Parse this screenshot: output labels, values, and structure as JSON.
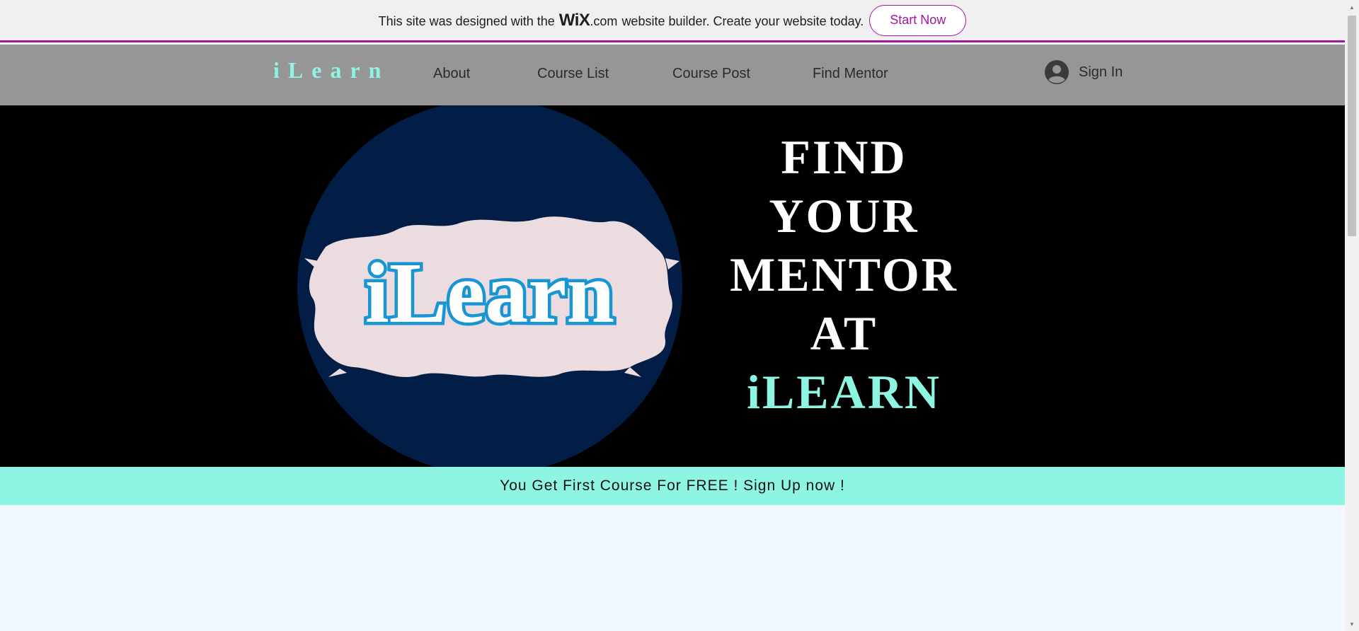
{
  "wix_banner": {
    "text_before": "This site was designed with the",
    "logo": "WiX",
    "logo_suffix": ".com",
    "text_after": "website builder. Create your website today.",
    "cta_label": "Start Now",
    "accent_color": "#a0179a"
  },
  "header": {
    "brand": "iLearn",
    "nav": [
      "About",
      "Course List",
      "Course Post",
      "Find Mentor"
    ],
    "signin_label": "Sign In",
    "signin_icon": "user-avatar-icon",
    "background_color": "#969696",
    "brand_color": "#8ff5e3"
  },
  "hero": {
    "logo_text": "iLearn",
    "headline_lines": [
      "FIND",
      "YOUR",
      "MENTOR",
      "AT"
    ],
    "headline_accent": "iLEARN",
    "circle_color": "#031e46",
    "accent_color": "#8ff5e3"
  },
  "promo": {
    "text": "You Get First Course For FREE ! Sign Up now !",
    "background_color": "#8ff5e3"
  }
}
